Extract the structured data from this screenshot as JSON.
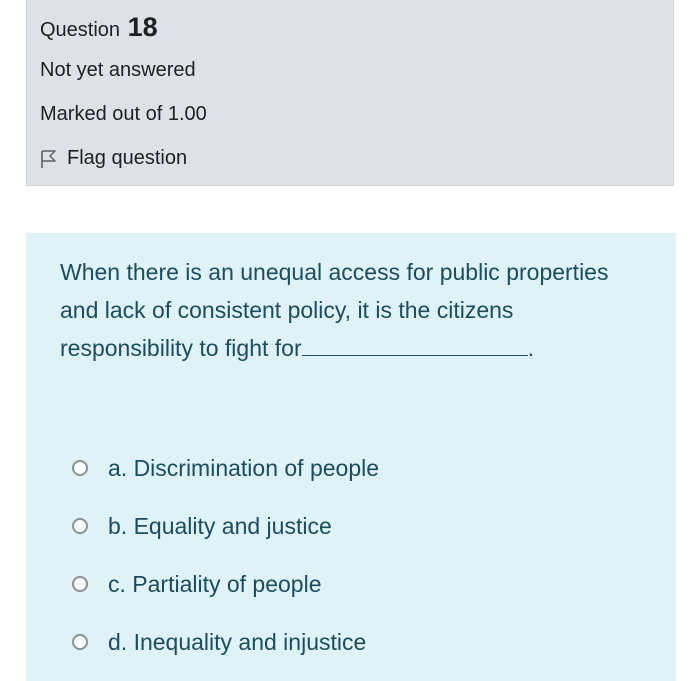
{
  "info": {
    "question_word": "Question",
    "question_number": "18",
    "state": "Not yet answered",
    "grade": "Marked out of 1.00",
    "flag_label": "Flag question"
  },
  "question": {
    "text_before": "When there is an unequal access for public properties and lack of consistent policy, it is the citizens responsibility to fight for",
    "text_after": "."
  },
  "answers": [
    {
      "label": "a. Discrimination of people"
    },
    {
      "label": "b. Equality and justice"
    },
    {
      "label": "c. Partiality of people"
    },
    {
      "label": "d. Inequality and injustice"
    }
  ],
  "colors": {
    "info_bg": "#dee2e6",
    "content_bg": "#def2f8",
    "question_text": "#1b4d5e"
  },
  "icons": {
    "flag": "flag-outline-icon"
  }
}
